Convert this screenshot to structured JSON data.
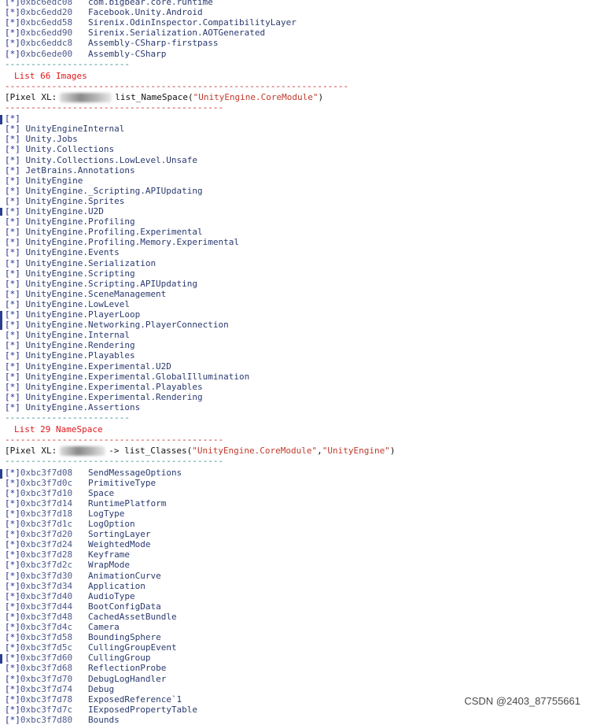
{
  "top_rows": [
    {
      "mark": "[*]",
      "addr": "0xbc6edc08",
      "name": "com.bigbear.core.runtime"
    },
    {
      "mark": "[*]",
      "addr": "0xbc6edd20",
      "name": "Facebook.Unity.Android"
    },
    {
      "mark": "[*]",
      "addr": "0xbc6edd58",
      "name": "Sirenix.OdinInspector.CompatibilityLayer"
    },
    {
      "mark": "[*]",
      "addr": "0xbc6edd90",
      "name": "Sirenix.Serialization.AOTGenerated"
    },
    {
      "mark": "[*]",
      "addr": "0xbc6eddc8",
      "name": "Assembly-CSharp-firstpass"
    },
    {
      "mark": "[*]",
      "addr": "0xbc6ede00",
      "name": "Assembly-CSharp"
    }
  ],
  "sep_short": "------------------------",
  "sep_long": "------------------------------------------------------------------------",
  "sep_mid": "------------------------------------------",
  "images_count_label": "List 66 Images",
  "cmd1": {
    "prefix": "[Pixel XL:",
    "suffix": "list_NameSpace(",
    "arg": "\"UnityEngine.CoreModule\"",
    "close": ")"
  },
  "namespaces": [
    "[*]",
    "[*] UnityEngineInternal",
    "[*] Unity.Jobs",
    "[*] Unity.Collections",
    "[*] Unity.Collections.LowLevel.Unsafe",
    "[*] JetBrains.Annotations",
    "[*] UnityEngine",
    "[*] UnityEngine._Scripting.APIUpdating",
    "[*] UnityEngine.Sprites",
    "[*] UnityEngine.U2D",
    "[*] UnityEngine.Profiling",
    "[*] UnityEngine.Profiling.Experimental",
    "[*] UnityEngine.Profiling.Memory.Experimental",
    "[*] UnityEngine.Events",
    "[*] UnityEngine.Serialization",
    "[*] UnityEngine.Scripting",
    "[*] UnityEngine.Scripting.APIUpdating",
    "[*] UnityEngine.SceneManagement",
    "[*] UnityEngine.LowLevel",
    "[*] UnityEngine.PlayerLoop",
    "[*] UnityEngine.Networking.PlayerConnection",
    "[*] UnityEngine.Internal",
    "[*] UnityEngine.Rendering",
    "[*] UnityEngine.Playables",
    "[*] UnityEngine.Experimental.U2D",
    "[*] UnityEngine.Experimental.GlobalIllumination",
    "[*] UnityEngine.Experimental.Playables",
    "[*] UnityEngine.Experimental.Rendering",
    "[*] UnityEngine.Assertions"
  ],
  "namespace_count_label": "List 29 NameSpace",
  "cmd2": {
    "prefix": "[Pixel XL:",
    "suffix": "-> list_Classes(",
    "arg1": "\"UnityEngine.CoreModule\"",
    "comma": ",",
    "arg2": "\"UnityEngine\"",
    "close": ")"
  },
  "classes": [
    {
      "mark": "[*]",
      "addr": "0xbc3f7d08",
      "name": "SendMessageOptions"
    },
    {
      "mark": "[*]",
      "addr": "0xbc3f7d0c",
      "name": "PrimitiveType"
    },
    {
      "mark": "[*]",
      "addr": "0xbc3f7d10",
      "name": "Space"
    },
    {
      "mark": "[*]",
      "addr": "0xbc3f7d14",
      "name": "RuntimePlatform"
    },
    {
      "mark": "[*]",
      "addr": "0xbc3f7d18",
      "name": "LogType"
    },
    {
      "mark": "[*]",
      "addr": "0xbc3f7d1c",
      "name": "LogOption"
    },
    {
      "mark": "[*]",
      "addr": "0xbc3f7d20",
      "name": "SortingLayer"
    },
    {
      "mark": "[*]",
      "addr": "0xbc3f7d24",
      "name": "WeightedMode"
    },
    {
      "mark": "[*]",
      "addr": "0xbc3f7d28",
      "name": "Keyframe"
    },
    {
      "mark": "[*]",
      "addr": "0xbc3f7d2c",
      "name": "WrapMode"
    },
    {
      "mark": "[*]",
      "addr": "0xbc3f7d30",
      "name": "AnimationCurve"
    },
    {
      "mark": "[*]",
      "addr": "0xbc3f7d34",
      "name": "Application"
    },
    {
      "mark": "[*]",
      "addr": "0xbc3f7d40",
      "name": "AudioType"
    },
    {
      "mark": "[*]",
      "addr": "0xbc3f7d44",
      "name": "BootConfigData"
    },
    {
      "mark": "[*]",
      "addr": "0xbc3f7d48",
      "name": "CachedAssetBundle"
    },
    {
      "mark": "[*]",
      "addr": "0xbc3f7d4c",
      "name": "Camera"
    },
    {
      "mark": "[*]",
      "addr": "0xbc3f7d58",
      "name": "BoundingSphere"
    },
    {
      "mark": "[*]",
      "addr": "0xbc3f7d5c",
      "name": "CullingGroupEvent"
    },
    {
      "mark": "[*]",
      "addr": "0xbc3f7d60",
      "name": "CullingGroup"
    },
    {
      "mark": "[*]",
      "addr": "0xbc3f7d68",
      "name": "ReflectionProbe"
    },
    {
      "mark": "[*]",
      "addr": "0xbc3f7d70",
      "name": "DebugLogHandler"
    },
    {
      "mark": "[*]",
      "addr": "0xbc3f7d74",
      "name": "Debug"
    },
    {
      "mark": "[*]",
      "addr": "0xbc3f7d78",
      "name": "ExposedReference`1"
    },
    {
      "mark": "[*]",
      "addr": "0xbc3f7d7c",
      "name": "IExposedPropertyTable"
    },
    {
      "mark": "[*]",
      "addr": "0xbc3f7d80",
      "name": "Bounds"
    }
  ],
  "watermark": "CSDN @2403_87755661"
}
